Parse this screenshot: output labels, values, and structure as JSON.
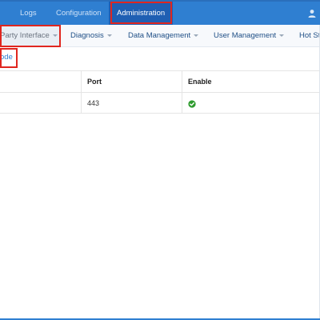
{
  "topnav": {
    "tabs": [
      {
        "label": "Logs"
      },
      {
        "label": "Configuration"
      },
      {
        "label": "Administration",
        "active": true
      }
    ],
    "user_icon": "user-icon"
  },
  "submenu": {
    "items": [
      {
        "label": "Party Interface",
        "current": true
      },
      {
        "label": "Diagnosis"
      },
      {
        "label": "Data Management"
      },
      {
        "label": "User Management"
      },
      {
        "label": "Hot St"
      }
    ]
  },
  "mode_tab": {
    "label": "ode"
  },
  "table": {
    "headers": [
      "",
      "Port",
      "Enable"
    ],
    "rows": [
      {
        "col1": "",
        "port": "443",
        "enable_icon": "check-circle-icon"
      }
    ]
  },
  "colors": {
    "primary": "#2f7fd1",
    "active_tab": "#1f5fb3",
    "highlight": "#e0261f",
    "enabled": "#2e9b2e"
  }
}
